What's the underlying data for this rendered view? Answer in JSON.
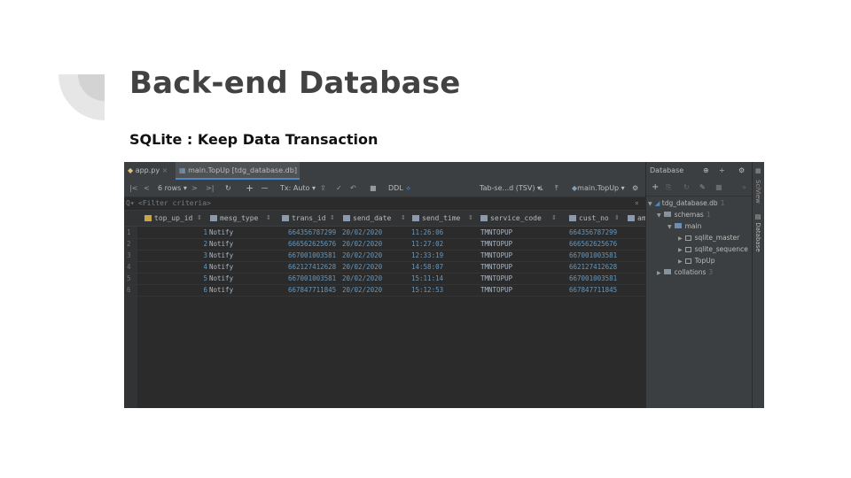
{
  "slide": {
    "title": "Back-end Database",
    "subtitle": "SQLite : Keep Data Transaction"
  },
  "ide": {
    "tabs": [
      {
        "label": "app.py",
        "icon": "python-file-icon",
        "active": false
      },
      {
        "label": "main.TopUp [tdg_database.db]",
        "icon": "table-icon",
        "active": true
      }
    ],
    "toolbar": {
      "rows_label": "6 rows",
      "tx_label": "Tx: Auto",
      "ddl_label": "DDL",
      "extractor_label": "Tab-se...d (TSV)",
      "table_label": "main.TopUp"
    },
    "filter_placeholder": "<Filter criteria>",
    "columns": [
      "top_up_id",
      "mesg_type",
      "trans_id",
      "send_date",
      "send_time",
      "service_code",
      "cust_no",
      "am"
    ],
    "rows": [
      {
        "rn": "1",
        "top_up_id": "1",
        "mesg_type": "Notify",
        "trans_id": "664356787299",
        "send_date": "20/02/2020",
        "send_time": "11:26:06",
        "service_code": "TMNTOPUP",
        "cust_no": "664356787299"
      },
      {
        "rn": "2",
        "top_up_id": "2",
        "mesg_type": "Notify",
        "trans_id": "666562625676",
        "send_date": "20/02/2020",
        "send_time": "11:27:02",
        "service_code": "TMNTOPUP",
        "cust_no": "666562625676"
      },
      {
        "rn": "3",
        "top_up_id": "3",
        "mesg_type": "Notify",
        "trans_id": "667001003581",
        "send_date": "20/02/2020",
        "send_time": "12:33:19",
        "service_code": "TMNTOPUP",
        "cust_no": "667001003581"
      },
      {
        "rn": "4",
        "top_up_id": "4",
        "mesg_type": "Notify",
        "trans_id": "662127412628",
        "send_date": "20/02/2020",
        "send_time": "14:58:07",
        "service_code": "TMNTOPUP",
        "cust_no": "662127412628"
      },
      {
        "rn": "5",
        "top_up_id": "5",
        "mesg_type": "Notify",
        "trans_id": "667001003581",
        "send_date": "20/02/2020",
        "send_time": "15:11:14",
        "service_code": "TMNTOPUP",
        "cust_no": "667001003581"
      },
      {
        "rn": "6",
        "top_up_id": "6",
        "mesg_type": "Notify",
        "trans_id": "667847711845",
        "send_date": "20/02/2020",
        "send_time": "15:12:53",
        "service_code": "TMNTOPUP",
        "cust_no": "667847711845"
      }
    ],
    "db_panel": {
      "title": "Database",
      "db_name": "tdg_database.db",
      "schemas_label": "schemas",
      "schemas_count": "1",
      "main_label": "main",
      "tables": [
        "sqlite_master",
        "sqlite_sequence",
        "TopUp"
      ],
      "collations_label": "collations",
      "collations_count": "3",
      "db_count": "1"
    },
    "side_strip": [
      "SciView",
      "Database"
    ]
  }
}
